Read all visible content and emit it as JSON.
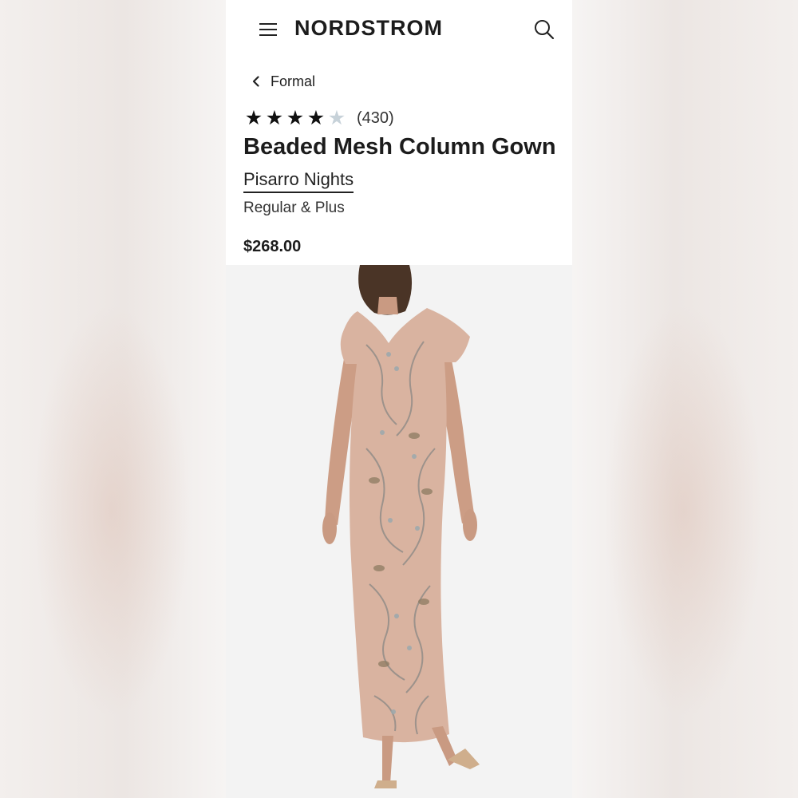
{
  "header": {
    "logo_text": "NORDSTROM",
    "menu_icon": "hamburger-menu-icon",
    "search_icon": "search-icon"
  },
  "breadcrumb": {
    "label": "Formal",
    "icon": "chevron-left-icon"
  },
  "product": {
    "rating": 4,
    "rating_max": 5,
    "review_count": "(430)",
    "title": "Beaded Mesh Column Gown",
    "brand": "Pisarro Nights",
    "size_range": "Regular & Plus",
    "price": "$268.00",
    "image": "product-photo-model-wearing-beaded-gown"
  },
  "colors": {
    "star_filled": "#111111",
    "star_empty": "#c7d2d9",
    "text": "#1c1c1c",
    "image_background": "#f3f3f3",
    "gown": "#d9b3a0"
  }
}
